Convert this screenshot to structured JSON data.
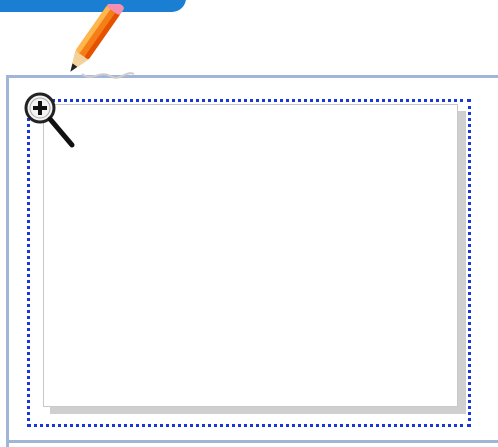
{
  "colors": {
    "accent": "#1a7fd2",
    "frame": "#9fb6d9",
    "dotted_border": "#1b37d8",
    "shadow": "#cfcfcf"
  },
  "icons": {
    "pencil": "pencil-icon",
    "zoom_in": "zoom-in-icon"
  }
}
